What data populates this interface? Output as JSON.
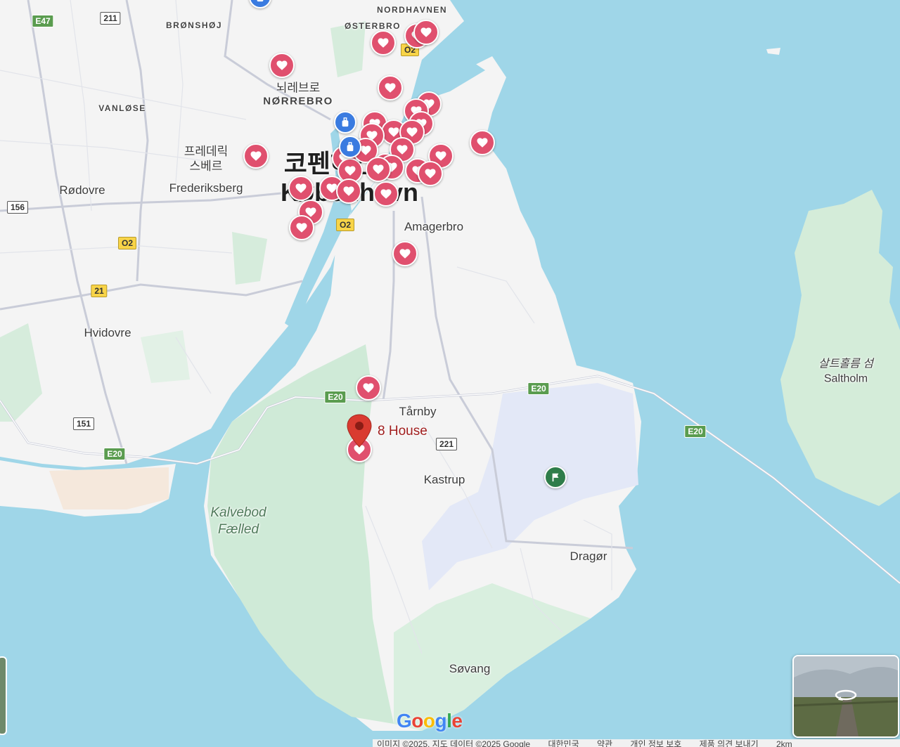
{
  "map": {
    "places": {
      "nordhavnen": "NORDHAVNEN",
      "osterbro": "ØSTERBRO",
      "bronshoj": "BRØNSHØJ",
      "vanlose": "VANLØSE",
      "norrebro_ko": "뇌레브로",
      "norrebro": "NØRREBRO",
      "frederiksberg_ko": "프레데릭\n스베르",
      "frederiksberg": "Frederiksberg",
      "rodovre": "Rødovre",
      "kobenhavn_ko": "코펜하겐",
      "kobenhavn": "København",
      "amagerbro": "Amagerbro",
      "hvidovre": "Hvidovre",
      "tarnby": "Tårnby",
      "kastrup": "Kastrup",
      "dragor": "Dragør",
      "sovang": "Søvang",
      "kalvebod": "Kalvebod Fælled",
      "saltholm_ko": "살트홀름 섬",
      "saltholm": "Saltholm"
    },
    "roads": {
      "e47": "E47",
      "r211": "211",
      "o2_a": "O2",
      "o2_b": "O2",
      "o2_c": "O2",
      "r156": "156",
      "r21": "21",
      "e20_a": "E20",
      "e20_b": "E20",
      "e20_c": "E20",
      "e20_d": "E20",
      "r151": "151",
      "r221": "221"
    },
    "selected_place": "8 House",
    "logo": "Google",
    "footer": [
      "이미지 ©2025, 지도 데이터 ©2025 Google",
      "대한민국",
      "약관",
      "개인 정보 보호",
      "제품 의견 보내기",
      "2km"
    ]
  },
  "colors": {
    "water": "#9fd6e8",
    "land": "#f4f4f4",
    "park": "#cfead7",
    "airport": "#e3e8f7",
    "heart_marker": "#e0506e",
    "hotel_marker": "#3a7be0",
    "pin": "#d93b30"
  }
}
